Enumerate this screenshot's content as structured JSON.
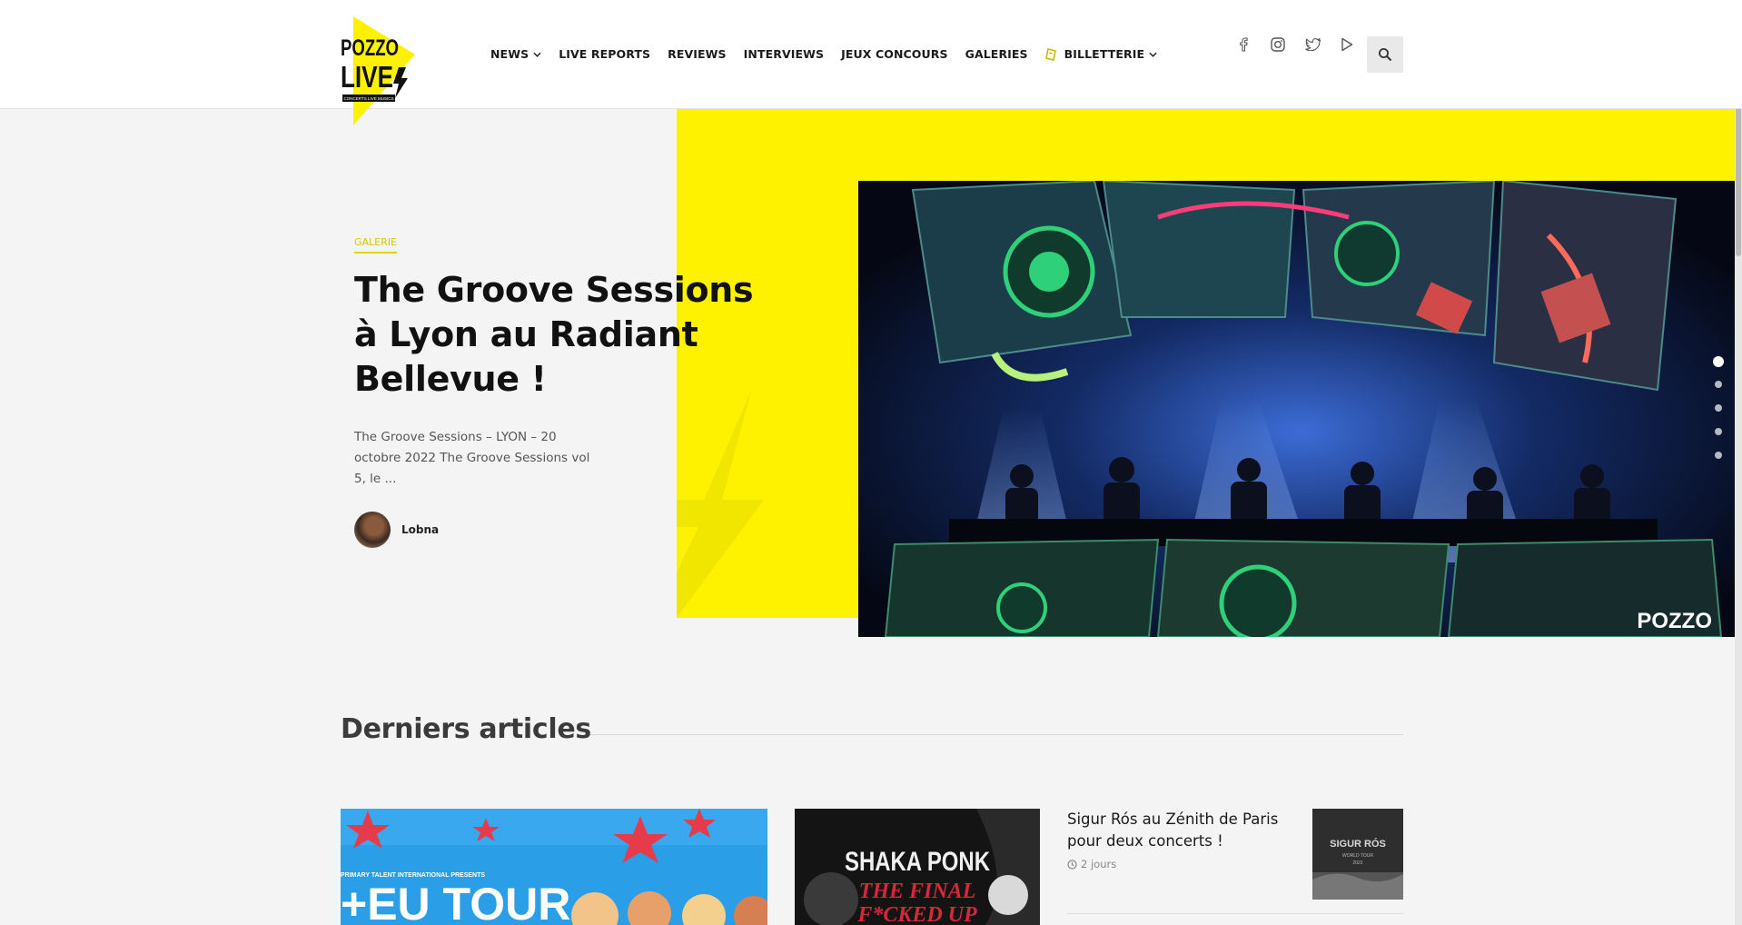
{
  "brand": {
    "logo_line1": "POZZO",
    "logo_line2": "LIVE",
    "logo_tag": "CONCERTS LIVE MUSICS"
  },
  "nav": {
    "items": [
      {
        "label": "NEWS",
        "dropdown": true
      },
      {
        "label": "LIVE REPORTS",
        "dropdown": false
      },
      {
        "label": "REVIEWS",
        "dropdown": false
      },
      {
        "label": "INTERVIEWS",
        "dropdown": false
      },
      {
        "label": "JEUX CONCOURS",
        "dropdown": false
      },
      {
        "label": "GALERIES",
        "dropdown": false
      },
      {
        "label": "BILLETTERIE",
        "dropdown": true,
        "icon": "ticket-icon"
      }
    ]
  },
  "social": [
    "facebook-icon",
    "instagram-icon",
    "twitter-icon",
    "youtube-icon"
  ],
  "search": {
    "icon": "search-icon"
  },
  "hero": {
    "category": "GALERIE",
    "title": "The Groove Sessions à Lyon au Radiant Bellevue !",
    "excerpt": "The Groove Sessions – LYON – 20 octobre 2022 The Groove Sessions vol 5, le ...",
    "author": "Lobna",
    "image_watermark": "POZZO",
    "slides_total": 5,
    "slide_active": 1
  },
  "latest": {
    "title": "Derniers articles",
    "card_big_text": "+EU TOUR",
    "card_big_small": "PRIMARY TALENT INTERNATIONAL PRESENTS",
    "card_mid_line1": "SHAKA PONK",
    "card_mid_line2": "THE FINAL",
    "card_mid_line3": "F*CKED UP",
    "side_article": {
      "title": "Sigur Rós au Zénith de Paris pour deux concerts !",
      "meta": "2 jours",
      "thumb_line1": "SIGUR RÓS",
      "thumb_line2": "WORLD TOUR",
      "thumb_line3": "2022"
    }
  },
  "colors": {
    "accent": "#fff200",
    "category": "#d6c600",
    "text": "#111111",
    "background": "#f4f4f4"
  }
}
